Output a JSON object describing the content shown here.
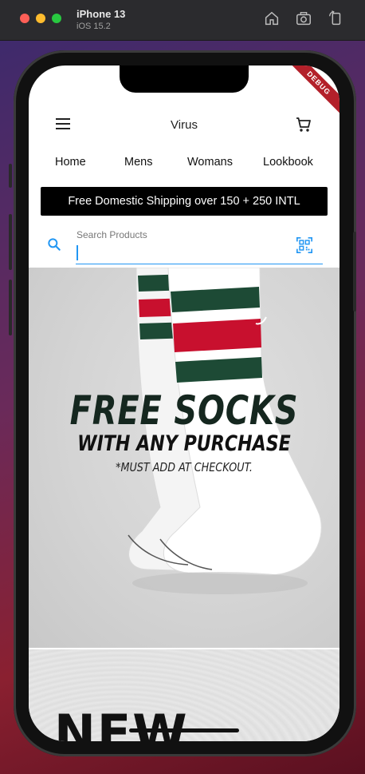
{
  "simulator": {
    "device": "iPhone 13",
    "os": "iOS 15.2"
  },
  "debug_banner": "DEBUG",
  "appbar": {
    "title": "Virus",
    "menu_icon": "menu-icon",
    "cart_icon": "shopping-cart-icon"
  },
  "nav": {
    "items": [
      {
        "label": "Home"
      },
      {
        "label": "Mens"
      },
      {
        "label": "Womans"
      },
      {
        "label": "Lookbook"
      }
    ]
  },
  "promo": {
    "text": "Free Domestic Shipping over 150 + 250 INTL"
  },
  "search": {
    "label": "Search Products",
    "value": "",
    "search_icon": "search-icon",
    "scan_icon": "qr-scan-icon"
  },
  "hero": {
    "line1": "FREE SOCKS",
    "line2": "WITH ANY PURCHASE",
    "line3": "*MUST ADD AT CHECKOUT."
  },
  "second_banner": {
    "text": "NEW"
  },
  "colors": {
    "accent": "#2196f3",
    "promo_bg": "#000000",
    "debug_ribbon": "#b3202a"
  }
}
